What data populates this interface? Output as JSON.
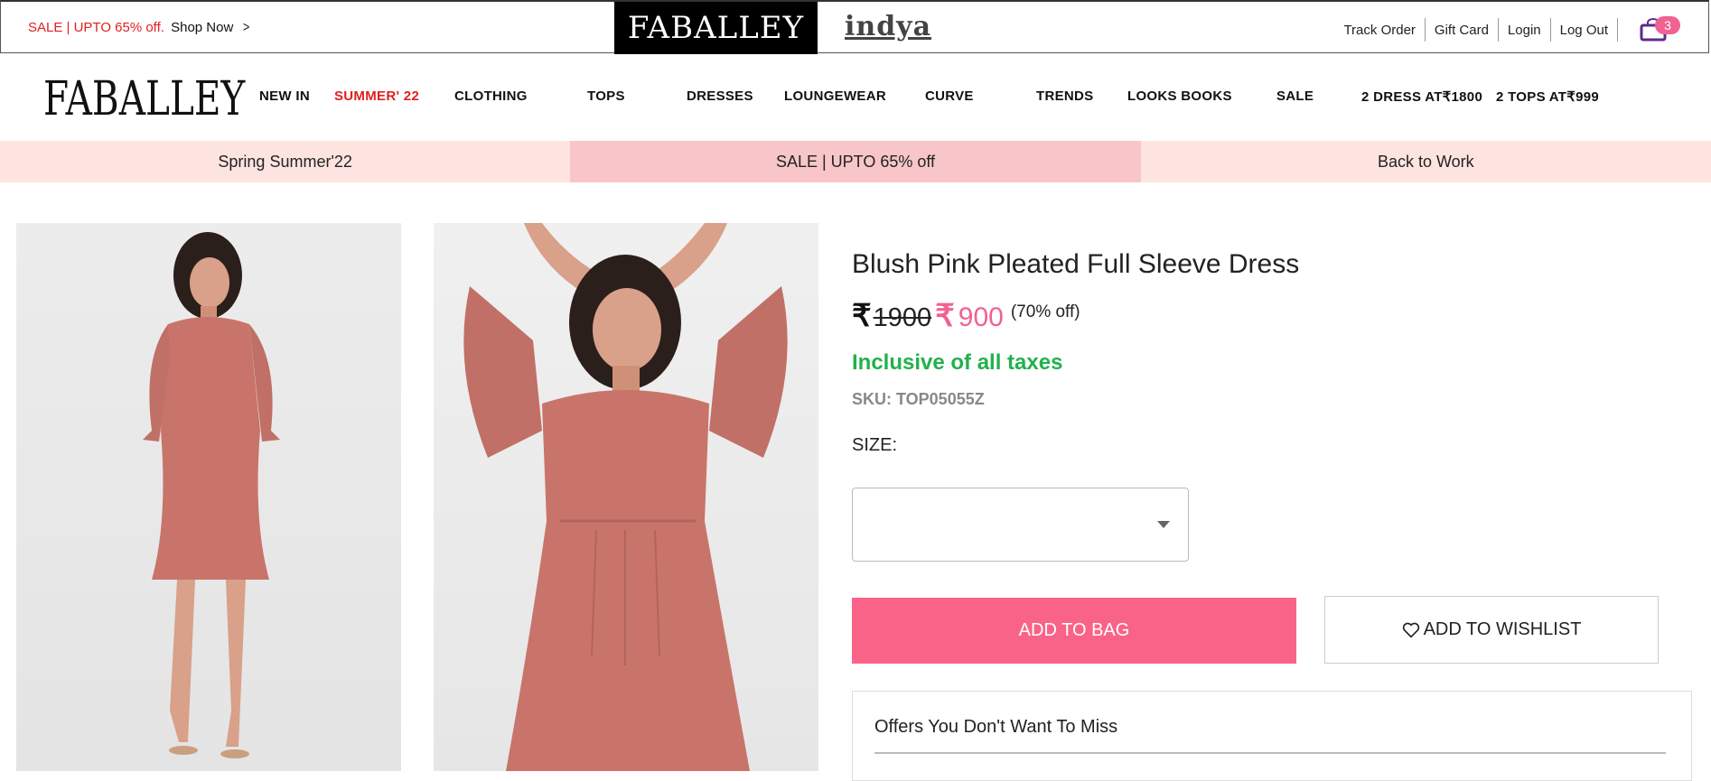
{
  "topbar": {
    "promo_red": "SALE | UPTO 65% off.",
    "promo_shop": "Shop Now",
    "brand_primary": "FABALLEY",
    "brand_secondary": "indya",
    "links": [
      "Track Order",
      "Gift Card",
      "Login",
      "Log Out"
    ],
    "cart_count": "3"
  },
  "nav": {
    "logo": "FABALLEY",
    "items": [
      "NEW IN",
      "SUMMER' 22",
      "CLOTHING",
      "TOPS",
      "DRESSES",
      "LOUNGEWEAR",
      "CURVE",
      "TRENDS",
      "LOOKS BOOKS",
      "SALE",
      "2 DRESS AT₹1800",
      "2 TOPS AT₹999"
    ]
  },
  "band": [
    "Spring Summer'22",
    "SALE | UPTO 65% off",
    "Back to Work"
  ],
  "product": {
    "title": "Blush Pink Pleated Full Sleeve Dress",
    "currency": "₹",
    "old_price": "1900",
    "new_price": "900",
    "discount": "(70% off)",
    "taxes": "Inclusive of all taxes",
    "sku": "SKU: TOP05055Z",
    "size_label": "SIZE:",
    "add_to_bag": "ADD TO BAG",
    "add_to_wishlist": "ADD TO WISHLIST",
    "offers_title": "Offers You Don't Want To Miss"
  },
  "colors": {
    "accent_pink": "#fa6388",
    "sale_red": "#e02020",
    "tax_green": "#22b14c"
  }
}
